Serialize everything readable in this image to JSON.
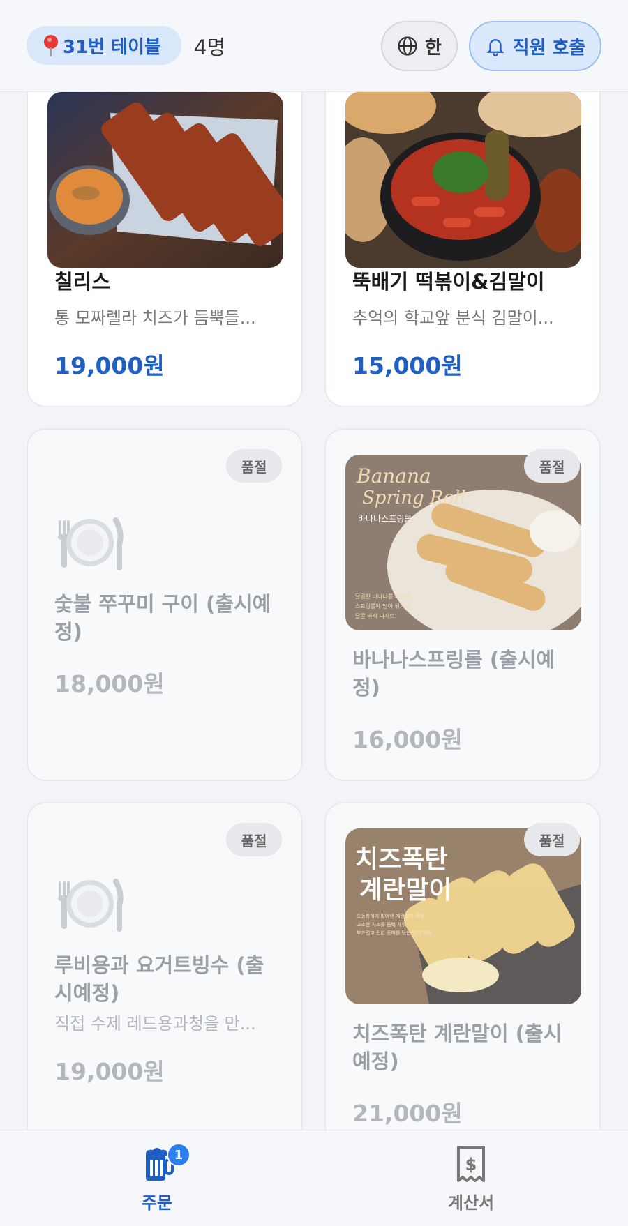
{
  "header": {
    "table_label": "31번 테이블",
    "guest_count": "4명",
    "language_label": "한",
    "call_staff_label": "직원 호출"
  },
  "menu": [
    {
      "name": "칠리스",
      "desc": "통 모짜렐라 치즈가 듬뿍들...",
      "price": "19,000원",
      "sold_out": false,
      "image": "fried-cheese-sticks-photo"
    },
    {
      "name": "뚝배기 떡볶이&김말이",
      "desc": "추억의 학교앞 분식 김말이...",
      "price": "15,000원",
      "sold_out": false,
      "image": "tteokbokki-photo"
    },
    {
      "name": "숯불 쭈꾸미 구이 (출시예정)",
      "desc": "",
      "price": "18,000원",
      "sold_out": true,
      "badge": "품절",
      "image": "plate-icon"
    },
    {
      "name": "바나나스프링롤 (출시예정)",
      "desc": "",
      "price": "16,000원",
      "sold_out": true,
      "badge": "품절",
      "image": "banana-spring-roll-photo",
      "image_text": {
        "title1": "Banana",
        "title2": "Spring Roll",
        "ko": "바나나스프링롤",
        "blurb1": "달콤한 바나나를 바삭한",
        "blurb2": "스프링롤에 담아 튀겨낸",
        "blurb3": "달콤 바삭 디저트!"
      }
    },
    {
      "name": "루비용과 요거트빙수 (출시예정)",
      "desc": "직접 수제 레드용과청을 만...",
      "price": "19,000원",
      "sold_out": true,
      "badge": "품절",
      "image": "plate-icon"
    },
    {
      "name": "치즈폭탄 계란말이 (출시예정)",
      "desc": "",
      "price": "21,000원",
      "sold_out": true,
      "badge": "품절",
      "image": "cheese-egg-roll-photo",
      "image_text": {
        "title1": "치즈폭탄",
        "title2": "계란말이",
        "blurb1": "오동통하게 말아낸 계란말이 속에",
        "blurb2": "고소한 치즈를 듬뿍 채워",
        "blurb3": "부드럽고 진한 풍미를 담은 인기 메뉴"
      }
    }
  ],
  "nav": {
    "order_label": "주문",
    "order_badge": "1",
    "bill_label": "계산서"
  },
  "colors": {
    "accent": "#1f5fc4",
    "badge_blue": "#2d7ff0",
    "background": "#f2f4f7"
  }
}
